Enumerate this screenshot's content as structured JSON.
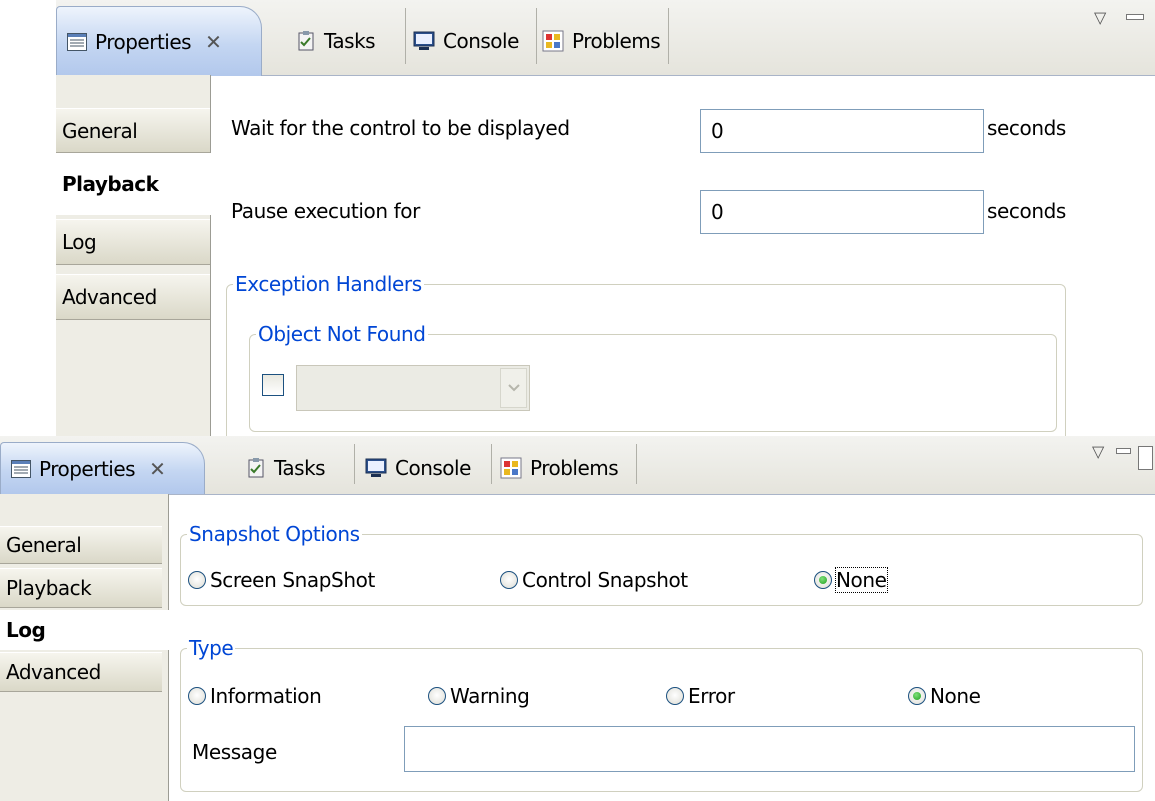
{
  "panel_top": {
    "tabs": {
      "properties": "Properties",
      "tasks": "Tasks",
      "console": "Console",
      "problems": "Problems"
    },
    "sidebar": [
      "General",
      "Playback",
      "Log",
      "Advanced"
    ],
    "selected_sidebar": "Playback",
    "wait_label": "Wait for the control to be displayed",
    "wait_value": "0",
    "wait_unit": "seconds",
    "pause_label": "Pause execution for",
    "pause_value": "0",
    "pause_unit": "seconds",
    "exception_group": "Exception Handlers",
    "object_not_found_group": "Object Not Found",
    "handler_checkbox_checked": false,
    "handler_select_value": ""
  },
  "panel_bottom": {
    "tabs": {
      "properties": "Properties",
      "tasks": "Tasks",
      "console": "Console",
      "problems": "Problems"
    },
    "sidebar": [
      "General",
      "Playback",
      "Log",
      "Advanced"
    ],
    "selected_sidebar": "Log",
    "snapshot_group": "Snapshot Options",
    "snapshot_options": [
      "Screen SnapShot",
      "Control Snapshot",
      "None"
    ],
    "snapshot_selected": "None",
    "type_group": "Type",
    "type_options": [
      "Information",
      "Warning",
      "Error",
      "None"
    ],
    "type_selected": "None",
    "message_label": "Message",
    "message_value": ""
  },
  "colors": {
    "group_title": "#0046d5",
    "active_tab": "#c4d6f2",
    "radio_on": "#21a121"
  }
}
